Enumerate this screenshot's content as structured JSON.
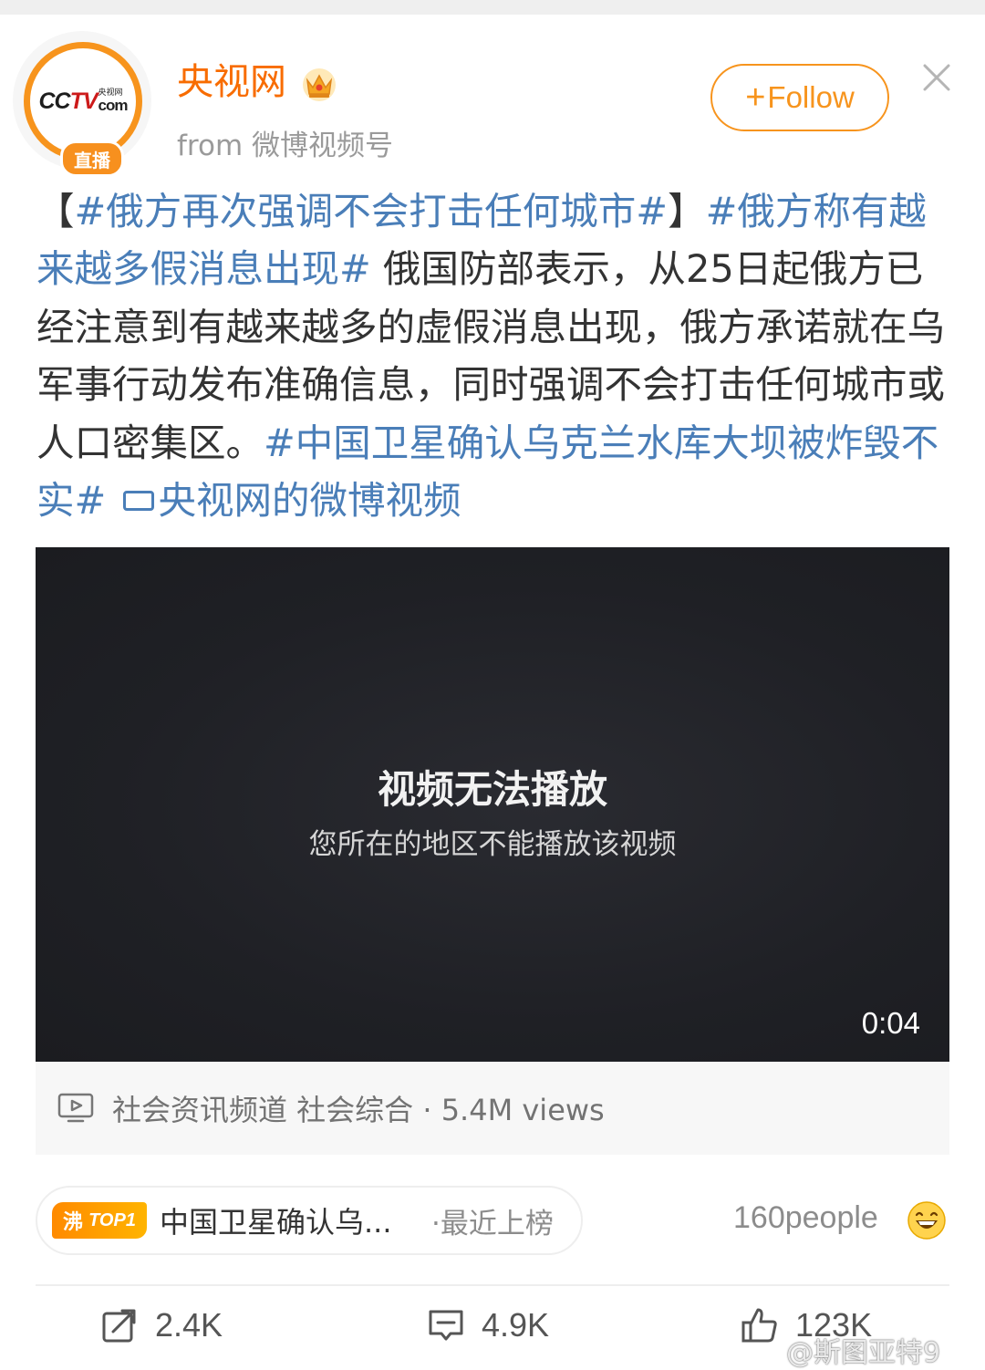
{
  "account": {
    "name": "央视网",
    "source": "from 微博视频号",
    "avatar_badge": "直播",
    "logo_text_main": "CCTV",
    "logo_text_small": "央视网",
    "logo_text_com": "com",
    "follow_label": "Follow",
    "verified_icon": "crown-icon",
    "close_icon": "close-icon"
  },
  "post": {
    "bracket_open": "【",
    "tag1": "#俄方再次强调不会打击任何城市#",
    "bracket_close": "】",
    "tag2": "#俄方称有越来越多假消息出现#",
    "body": "俄国防部表示，从25日起俄方已经注意到有越来越多的虚假消息出现，俄方承诺就在乌军事行动发布准确信息，同时强调不会打击任何城市或人口密集区。",
    "tag3": "#中国卫星确认乌克兰水库大坝被炸毁不实#",
    "video_link": "央视网的微博视频"
  },
  "video": {
    "title": "视频无法播放",
    "subtitle": "您所在的地区不能播放该视频",
    "duration": "0:04",
    "meta": "社会资讯频道 社会综合 · 5.4M views"
  },
  "hot": {
    "badge_char": "沸",
    "badge_rank": "TOP1",
    "title": "中国卫星确认乌...",
    "suffix": "·最近上榜",
    "people": "160people"
  },
  "actions": {
    "repost": "2.4K",
    "comment": "4.9K",
    "like": "123K"
  },
  "watermark": "@斯图亚特9",
  "colors": {
    "accent_orange": "#f7941d",
    "username_orange": "#f86c00",
    "link_blue": "#4a7eb8",
    "video_bg": "#1f2025"
  }
}
